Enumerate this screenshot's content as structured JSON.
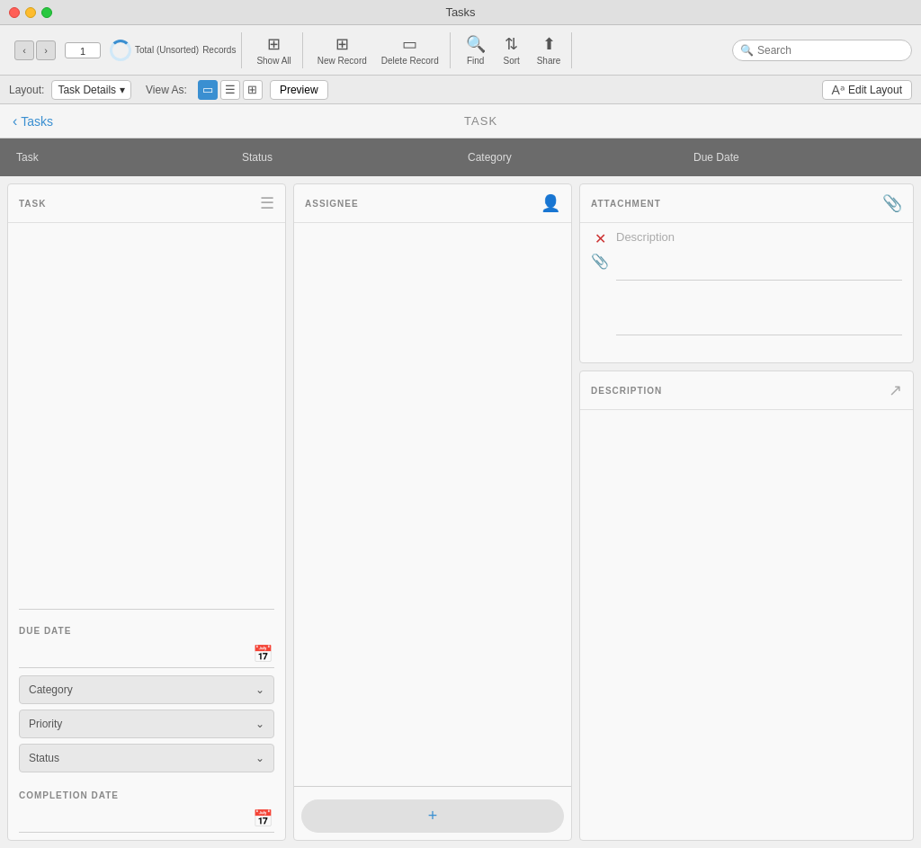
{
  "window": {
    "title": "Tasks"
  },
  "toolbar": {
    "records_label": "Records",
    "show_all_label": "Show All",
    "new_record_label": "New Record",
    "delete_record_label": "Delete Record",
    "find_label": "Find",
    "sort_label": "Sort",
    "share_label": "Share",
    "record_number": "1",
    "total_label": "Total (Unsorted)"
  },
  "search": {
    "placeholder": "Search"
  },
  "layout_bar": {
    "layout_label": "Layout:",
    "layout_value": "Task Details",
    "view_as_label": "View As:",
    "preview_label": "Preview",
    "edit_layout_label": "Edit Layout"
  },
  "nav": {
    "back_label": "Tasks",
    "page_title": "TASK"
  },
  "table_header": {
    "columns": [
      "Task",
      "Status",
      "Category",
      "Due Date"
    ]
  },
  "left_panel": {
    "title": "TASK",
    "due_date_label": "DUE DATE",
    "category_label": "Category",
    "priority_label": "Priority",
    "status_label": "Status",
    "completion_date_label": "COMPLETION DATE"
  },
  "middle_panel": {
    "title": "ASSIGNEE",
    "add_icon": "+"
  },
  "right_panel": {
    "attachment_title": "ATTACHMENT",
    "description_placeholder": "Description",
    "description_title": "DESCRIPTION"
  }
}
